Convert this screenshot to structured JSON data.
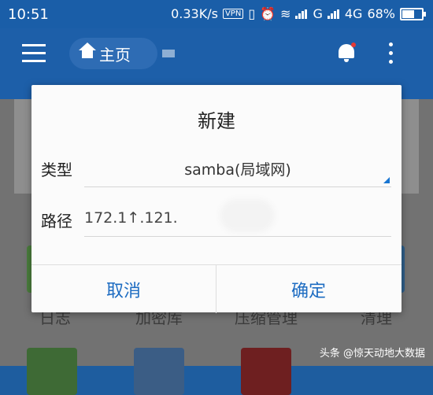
{
  "status_bar": {
    "time": "10:51",
    "net_speed": "0.33K/s",
    "vpn": "VPN",
    "net_type_1": "G",
    "net_type_2": "4G",
    "battery": "68%",
    "battery_level": 0.68
  },
  "app_bar": {
    "home_label": "主页"
  },
  "background": {
    "labels": [
      "日志",
      "加密库",
      "压缩管理",
      "清理"
    ]
  },
  "dialog": {
    "title": "新建",
    "type_label": "类型",
    "type_value": "samba(局域网)",
    "path_label": "路径",
    "path_value": "172.1↑.121.",
    "cancel_label": "取消",
    "confirm_label": "确定"
  },
  "watermark": "头条 @惊天动地大数据",
  "colors": {
    "primary": "#1d5fa9",
    "accent": "#1d6cc2"
  }
}
